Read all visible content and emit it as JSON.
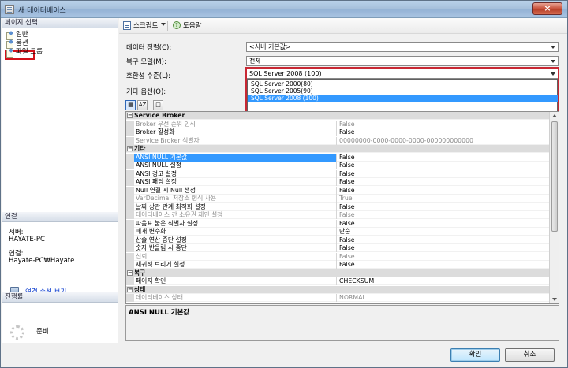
{
  "window": {
    "title": "새 데이터베이스",
    "close_glyph": "×"
  },
  "left": {
    "pages_header": "페이지 선택",
    "pages": [
      {
        "label": "일반",
        "icon": "page-icon"
      },
      {
        "label": "옵션",
        "icon": "page-icon",
        "selected": true
      },
      {
        "label": "파일 그룹",
        "icon": "page-icon"
      }
    ],
    "connection_header": "연결",
    "server_label": "서버:",
    "server_value": "HAYATE-PC",
    "connection_label": "연결:",
    "connection_value": "Hayate-PC₩Hayate",
    "view_connection_link": "연결 속성 보기",
    "progress_header": "진행률",
    "progress_status": "준비"
  },
  "toolbar": {
    "script_label": "스크립트",
    "help_label": "도움말"
  },
  "form": {
    "collation": {
      "label": "데이터 정렬(C):",
      "value": "<서버 기본값>"
    },
    "recovery_model": {
      "label": "복구 모델(M):",
      "value": "전체"
    },
    "compatibility": {
      "label": "호환성 수준(L):",
      "value": "SQL Server 2008 (100)",
      "options": [
        "SQL Server 2000(80)",
        "SQL Server 2005(90)",
        "SQL Server 2008 (100)"
      ],
      "selected_index": 2
    },
    "other_options_label": "기타 옵션(O):"
  },
  "view_buttons": {
    "categorized": "▦",
    "alphabetical": "AZ",
    "property_pages": "□"
  },
  "property_grid": {
    "rows": [
      {
        "type": "category",
        "name": "Service Broker"
      },
      {
        "name": "Broker 우선 순위 인식",
        "value": "False",
        "dim": true
      },
      {
        "name": "Broker 활성화",
        "value": "False"
      },
      {
        "name": "Service Broker 식별자",
        "value": "00000000-0000-0000-0000-000000000000",
        "dim": true
      },
      {
        "type": "category",
        "name": "기타"
      },
      {
        "name": "ANSI NULL 기본값",
        "value": "False",
        "selected": true
      },
      {
        "name": "ANSI NULL 설정",
        "value": "False"
      },
      {
        "name": "ANSI 경고 설정",
        "value": "False"
      },
      {
        "name": "ANSI 패딩 설정",
        "value": "False"
      },
      {
        "name": "Null 연결 시 Null 생성",
        "value": "False"
      },
      {
        "name": "VarDecimal 저장소 형식 사용",
        "value": "True",
        "dim": true
      },
      {
        "name": "날짜 상관 관계 최적화 설정",
        "value": "False"
      },
      {
        "name": "데이터베이스 간 소유권 체인 설정",
        "value": "False",
        "dim": true
      },
      {
        "name": "따옴표 붙은 식별자 설정",
        "value": "False"
      },
      {
        "name": "매개 변수화",
        "value": "단순"
      },
      {
        "name": "산술 연산 중단 설정",
        "value": "False"
      },
      {
        "name": "숫자 반올림 시 중단",
        "value": "False"
      },
      {
        "name": "신뢰",
        "value": "False",
        "dim": true
      },
      {
        "name": "재귀적 트리거 설정",
        "value": "False"
      },
      {
        "type": "category",
        "name": "복구"
      },
      {
        "name": "페이지 확인",
        "value": "CHECKSUM"
      },
      {
        "type": "category",
        "name": "상태"
      },
      {
        "name": "데이터베이스 상태",
        "value": "NORMAL",
        "dim": true
      }
    ]
  },
  "description": {
    "title": "ANSI NULL 기본값"
  },
  "buttons": {
    "ok": "확인",
    "cancel": "취소"
  }
}
